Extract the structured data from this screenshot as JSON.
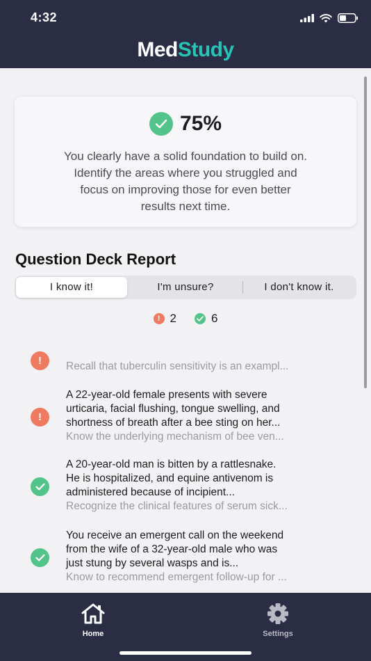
{
  "status_bar": {
    "time": "4:32"
  },
  "header": {
    "logo_part1": "Med",
    "logo_part2": "Study",
    "accent_color": "#27c3b5",
    "bg_color": "#2a2d44"
  },
  "score_card": {
    "score": "75%",
    "icon": "check-circle-icon",
    "message_lines": [
      "You clearly have a solid foundation to build on.",
      "Identify the areas where you struggled and",
      "focus on improving those for even better",
      "results next time."
    ]
  },
  "report": {
    "title": "Question Deck Report",
    "segments": [
      "I know it!",
      "I'm unsure?",
      "I don't know it."
    ],
    "selected_segment": "I know it!",
    "counts": {
      "incorrect": "2",
      "correct": "6"
    }
  },
  "questions": [
    {
      "status": "incorrect",
      "question_lines": [],
      "summary": "Recall that tuberculin sensitivity is an exampl..."
    },
    {
      "status": "incorrect",
      "question_lines": [
        "A 22-year-old female presents with severe",
        "urticaria, facial flushing, tongue swelling, and",
        "shortness of breath after a bee sting on her..."
      ],
      "summary": "Know the underlying mechanism of bee ven..."
    },
    {
      "status": "correct",
      "question_lines": [
        "A 20-year-old man is bitten by a rattlesnake.",
        "He is hospitalized, and equine antivenom is",
        "administered because of incipient..."
      ],
      "summary": "Recognize the clinical features of serum sick..."
    },
    {
      "status": "correct",
      "question_lines": [
        "You receive an emergent call on the weekend",
        "from the wife of a 32-year-old male who was",
        "just stung by several wasps and is..."
      ],
      "summary": "Know to recommend emergent follow-up for ..."
    }
  ],
  "tab_bar": {
    "tabs": [
      {
        "label": "Home",
        "icon": "home-icon",
        "active": true
      },
      {
        "label": "Settings",
        "icon": "gear-icon",
        "active": false
      }
    ]
  },
  "colors": {
    "correct": "#52c48a",
    "incorrect": "#f07a60"
  }
}
